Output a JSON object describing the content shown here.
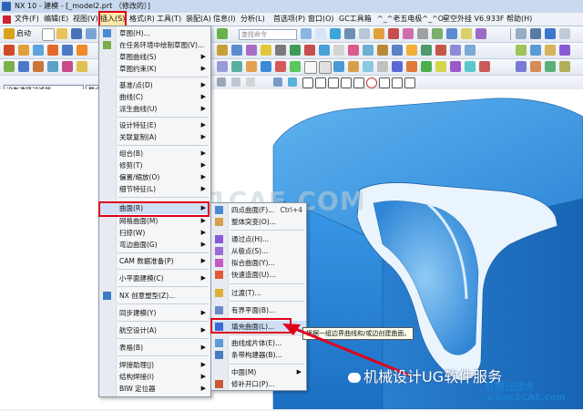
{
  "window": {
    "title": "NX 10 - 建模 - [_model2.prt （修改的）]"
  },
  "menubar": {
    "items": [
      "文件(F)",
      "编辑(E)",
      "视图(V)",
      "插入(S)",
      "格式(R)",
      "工具(T)",
      "装配(A)",
      "信息(I)",
      "分析(L)",
      "首选项(P)",
      "窗口(O)",
      "GC工具箱",
      "^_^老五电极^_^O",
      "星空外挂 V6.933F",
      "帮助(H)"
    ],
    "active": "插入(S)"
  },
  "toolbar": {
    "start_label": "启动",
    "command_search_placeholder": "查找命令",
    "filter_value": "没有选择过滤器",
    "filter2_value": "整个"
  },
  "insert_menu": {
    "items": [
      {
        "label": "草图(H)...",
        "icon": "sketch-icon",
        "submenu": false
      },
      {
        "label": "在任务环境中绘制草图(V)...",
        "icon": "task-sketch-icon",
        "submenu": false
      },
      {
        "label": "草图曲线(S)",
        "submenu": true
      },
      {
        "label": "草图约束(K)",
        "submenu": true
      },
      {
        "label": "基准/点(D)",
        "submenu": true
      },
      {
        "label": "曲线(C)",
        "submenu": true
      },
      {
        "label": "派生曲线(U)",
        "submenu": true
      },
      {
        "label": "设计特征(E)",
        "submenu": true
      },
      {
        "label": "关联复制(A)",
        "submenu": true
      },
      {
        "label": "组合(B)",
        "submenu": true
      },
      {
        "label": "修剪(T)",
        "submenu": true
      },
      {
        "label": "偏置/缩放(O)",
        "submenu": true
      },
      {
        "label": "细节特征(L)",
        "submenu": true
      },
      {
        "label": "曲面(R)",
        "submenu": true
      },
      {
        "label": "网格曲面(M)",
        "submenu": true
      },
      {
        "label": "扫掠(W)",
        "submenu": true
      },
      {
        "label": "弯边曲面(G)",
        "submenu": true
      },
      {
        "label": "CAM 数据准备(P)",
        "submenu": true
      },
      {
        "label": "小平面建模(C)",
        "submenu": true
      },
      {
        "label": "NX 创意塑型(Z)...",
        "icon": "nx-realize-icon",
        "submenu": false
      },
      {
        "label": "同步建模(Y)",
        "submenu": true
      },
      {
        "label": "航空设计(A)",
        "submenu": true
      },
      {
        "label": "表格(B)",
        "submenu": true
      },
      {
        "label": "焊接助理(J)",
        "submenu": true
      },
      {
        "label": "结构焊接(I)",
        "submenu": true
      },
      {
        "label": "BIW 定位器",
        "submenu": true
      }
    ],
    "highlighted": "曲面(R)"
  },
  "surface_menu": {
    "items": [
      {
        "label": "四点曲面(F)...",
        "shortcut": "Ctrl+4",
        "submenu": false
      },
      {
        "label": "整体突变(O)...",
        "submenu": false
      },
      {
        "label": "通过点(H)...",
        "submenu": false
      },
      {
        "label": "从极点(S)...",
        "submenu": false
      },
      {
        "label": "拟合曲面(Y)...",
        "submenu": false
      },
      {
        "label": "快速造面(U)...",
        "submenu": false
      },
      {
        "label": "过渡(T)...",
        "submenu": false
      },
      {
        "label": "有界平面(B)...",
        "submenu": false
      },
      {
        "label": "填充曲面(L)...",
        "submenu": false
      },
      {
        "label": "曲线成片体(E)...",
        "submenu": false
      },
      {
        "label": "条带构建器(B)...",
        "submenu": false
      },
      {
        "label": "中面(M)",
        "submenu": true
      },
      {
        "label": "修补开口(P)...",
        "submenu": false
      }
    ],
    "highlighted": "填充曲面(L)..."
  },
  "tooltip": {
    "text": "根据一组边界曲线和/或边创建曲面。"
  },
  "watermarks": {
    "center": "1CAE.COM",
    "wechat": "机械设计UG软件服务",
    "site_line1": "有限元技术",
    "site_line2": "www.1CAE.com"
  },
  "colors": {
    "accent_red": "#e0001b",
    "menu_highlight": "#cfe0f6",
    "model_blue": "#2f8bd8"
  }
}
